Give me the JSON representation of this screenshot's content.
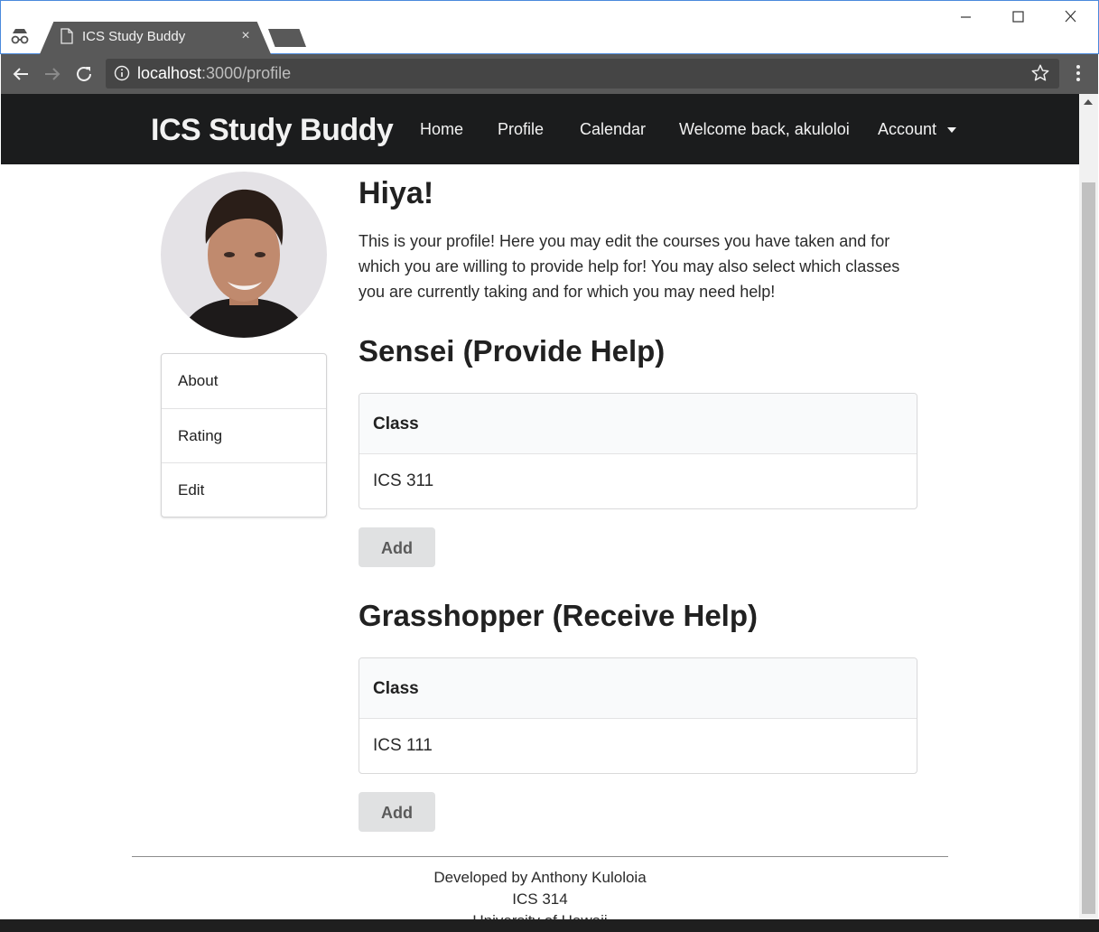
{
  "browser": {
    "tab_title": "ICS Study Buddy",
    "tab_close": "×",
    "url_host": "localhost",
    "url_rest": ":3000/profile"
  },
  "navbar": {
    "brand": "ICS Study Buddy",
    "links": [
      "Home",
      "Profile",
      "Calendar",
      "Welcome back, akuloloi",
      "Account"
    ]
  },
  "sidebar": {
    "items": [
      {
        "label": "About"
      },
      {
        "label": "Rating"
      },
      {
        "label": "Edit"
      }
    ]
  },
  "main": {
    "greeting": "Hiya!",
    "intro": "This is your profile! Here you may edit the courses you have taken and for which you are willing to provide help for! You may also select which classes you are currently taking and for which you may need help!",
    "sensei": {
      "title": "Sensei (Provide Help)",
      "column_header": "Class",
      "rows": [
        "ICS 311"
      ],
      "add_label": "Add"
    },
    "grasshopper": {
      "title": "Grasshopper (Receive Help)",
      "column_header": "Class",
      "rows": [
        "ICS 111"
      ],
      "add_label": "Add"
    }
  },
  "footer": {
    "lines": [
      "Developed by Anthony Kuloloia",
      "ICS 314",
      "University of Hawaii"
    ]
  },
  "colors": {
    "navbar_bg": "#1b1c1d",
    "chrome_toolbar": "#595959",
    "button_bg": "#e0e1e2"
  }
}
